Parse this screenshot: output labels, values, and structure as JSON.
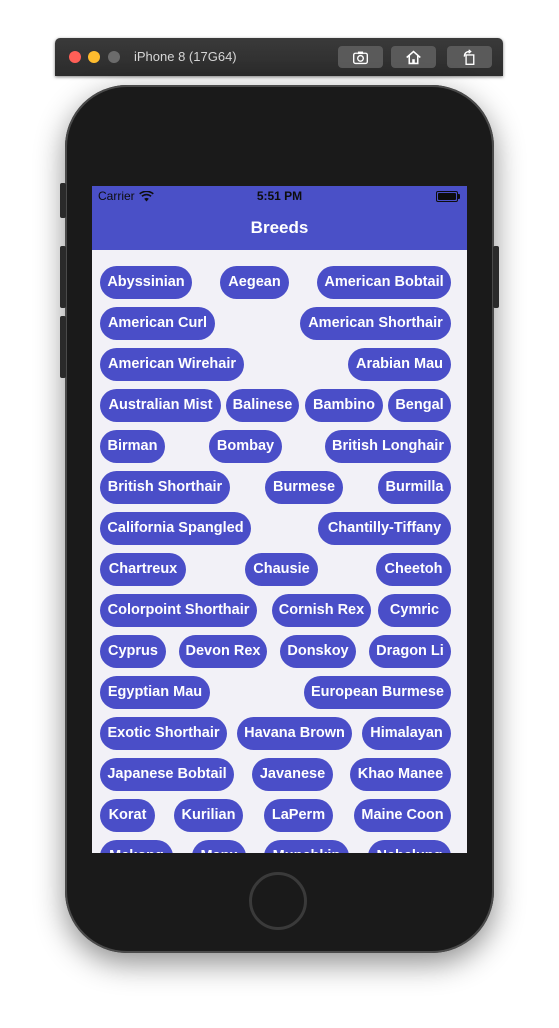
{
  "simulator": {
    "title": "iPhone 8 (17G64)",
    "buttons": [
      {
        "name": "screenshot-button",
        "icon": "camera-icon"
      },
      {
        "name": "home-nav-button",
        "icon": "home-icon"
      },
      {
        "name": "rotate-button",
        "icon": "rotate-icon"
      }
    ]
  },
  "status_bar": {
    "carrier": "Carrier",
    "time": "5:51 PM"
  },
  "nav": {
    "title": "Breeds"
  },
  "colors": {
    "accent": "#4a50c7",
    "chip": "#4a4ec8",
    "background": "#f2f1f7"
  },
  "breeds": [
    "Abyssinian",
    "Aegean",
    "American Bobtail",
    "American Curl",
    "American Shorthair",
    "American Wirehair",
    "Arabian Mau",
    "Australian Mist",
    "Balinese",
    "Bambino",
    "Bengal",
    "Birman",
    "Bombay",
    "British Longhair",
    "British Shorthair",
    "Burmese",
    "Burmilla",
    "California Spangled",
    "Chantilly-Tiffany",
    "Chartreux",
    "Chausie",
    "Cheetoh",
    "Colorpoint Shorthair",
    "Cornish Rex",
    "Cymric",
    "Cyprus",
    "Devon Rex",
    "Donskoy",
    "Dragon Li",
    "Egyptian Mau",
    "European Burmese",
    "Exotic Shorthair",
    "Havana Brown",
    "Himalayan",
    "Japanese Bobtail",
    "Javanese",
    "Khao Manee",
    "Korat",
    "Kurilian",
    "LaPerm",
    "Maine Coon",
    "Mekong",
    "Manx",
    "Munchkin",
    "Nebelung"
  ]
}
